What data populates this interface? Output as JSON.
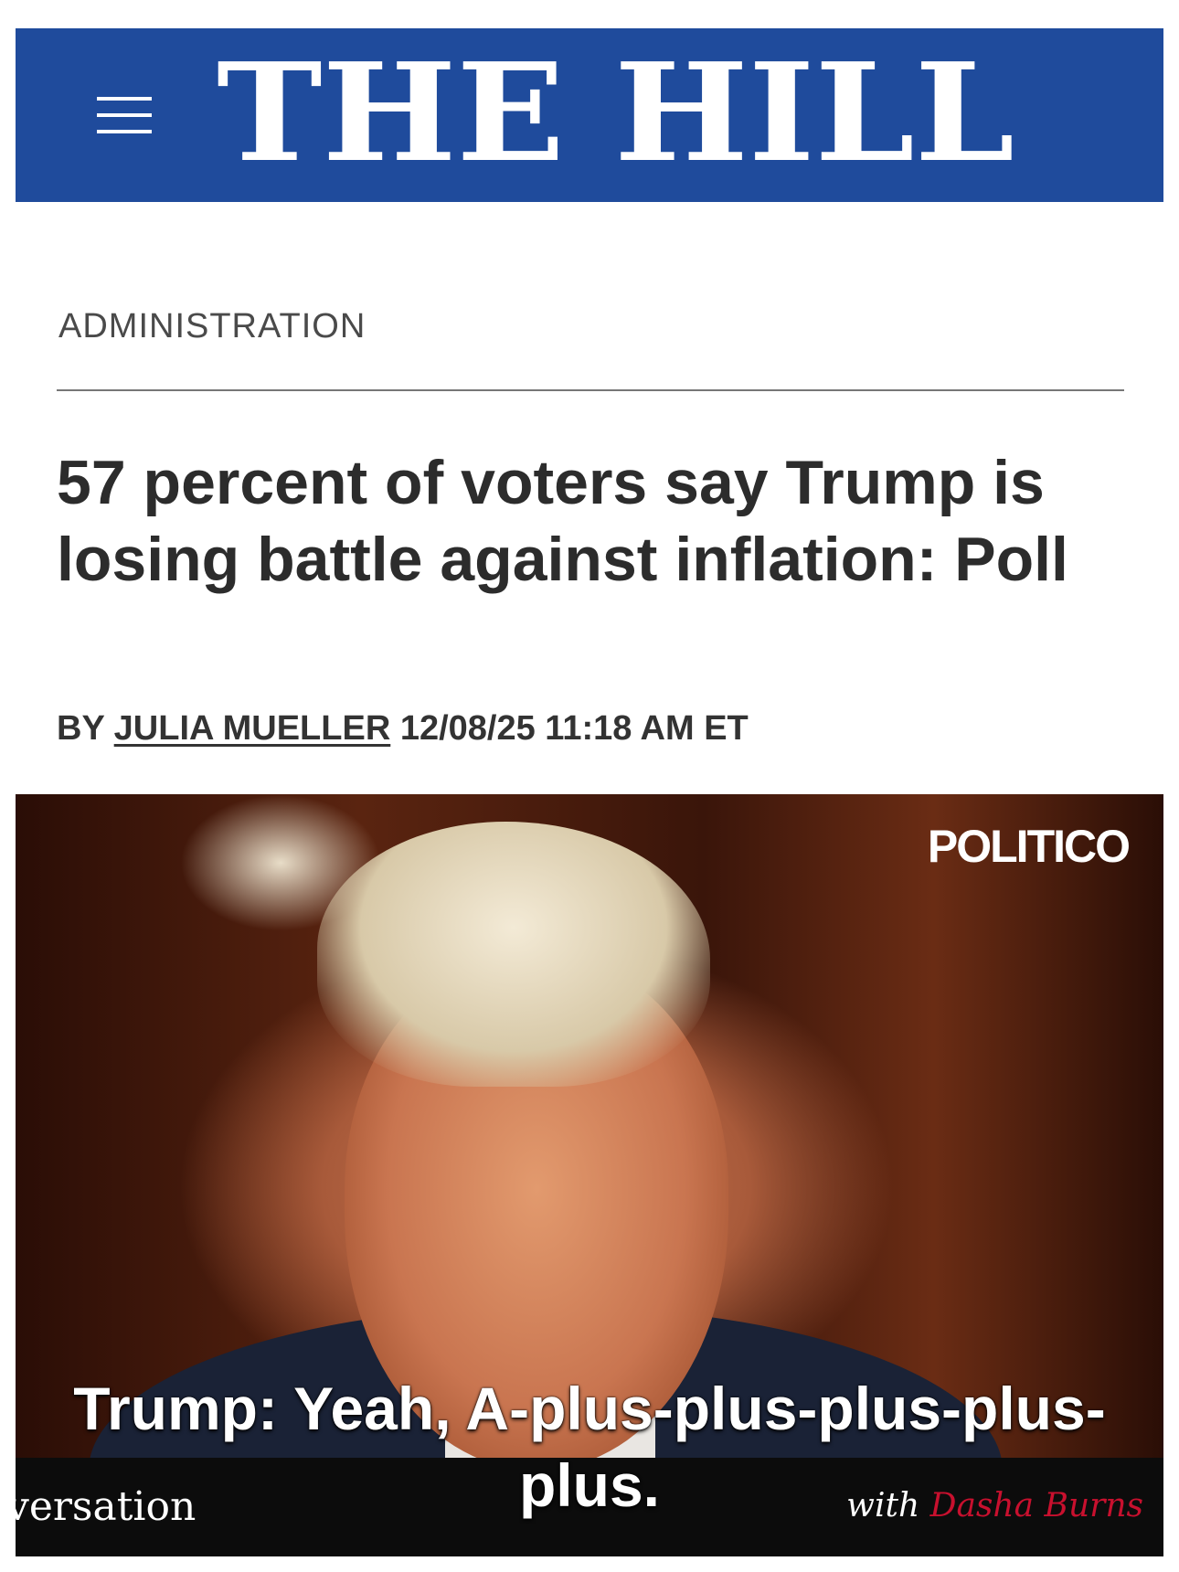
{
  "masthead": {
    "title": "THE HILL",
    "background_color": "#1f4b9c",
    "menu_icon": "hamburger-menu-icon"
  },
  "article": {
    "category": "ADMINISTRATION",
    "headline": "57 percent of voters say Trump is losing battle against inflation: Poll",
    "byline_prefix": "BY",
    "author": "JULIA MUELLER",
    "timestamp": "12/08/25 11:18 AM ET"
  },
  "video": {
    "brand_logo": "POLITICO",
    "caption": "Trump: Yeah, A-plus-plus-plus-plus-plus.",
    "show_name_fragment": "versation",
    "host_prefix": "with",
    "host_name": "Dasha Burns",
    "host_color": "#c8102e"
  }
}
